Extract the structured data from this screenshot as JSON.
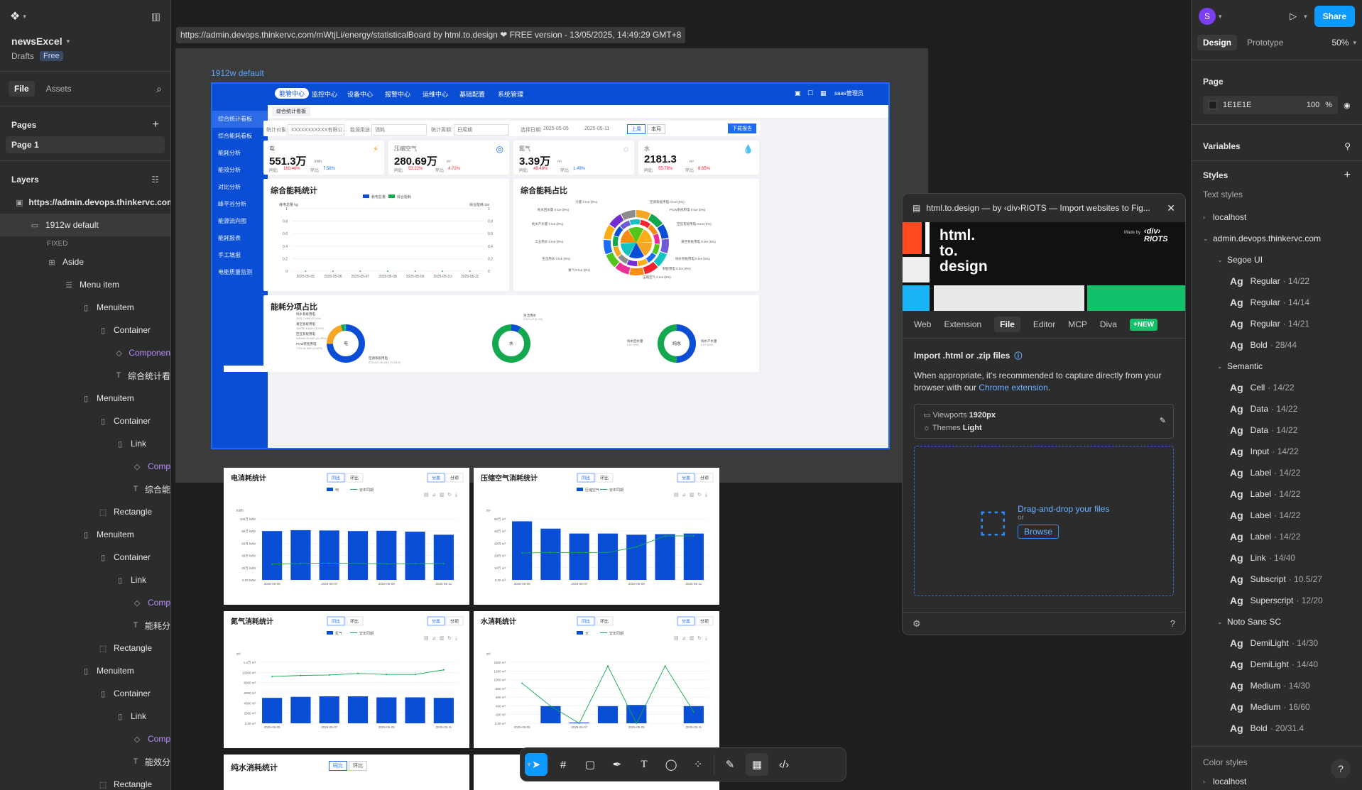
{
  "left": {
    "file_name": "newsExcel",
    "drafts": "Drafts",
    "plan": "Free",
    "tab_file": "File",
    "tab_assets": "Assets",
    "pages_title": "Pages",
    "page1": "Page 1",
    "layers_title": "Layers",
    "layers": [
      {
        "label": "https://admin.devops.thinkervc.com/",
        "icon": "▣",
        "indent": 16,
        "bold": true
      },
      {
        "label": "1912w default",
        "icon": "▭",
        "indent": 36
      },
      {
        "label": "FIXED",
        "icon": "",
        "indent": 60,
        "small": true
      },
      {
        "label": "Aside",
        "icon": "⊞",
        "indent": 60
      },
      {
        "label": "Menu item",
        "icon": "☰",
        "indent": 84
      },
      {
        "label": "Menuitem",
        "icon": "▯",
        "indent": 108
      },
      {
        "label": "Container",
        "icon": "▯",
        "indent": 132
      },
      {
        "label": "Componen",
        "icon": "◇",
        "indent": 156,
        "purple": true
      },
      {
        "label": "综合统计看",
        "icon": "T",
        "indent": 156
      },
      {
        "label": "Menuitem",
        "icon": "▯",
        "indent": 108
      },
      {
        "label": "Container",
        "icon": "▯",
        "indent": 132
      },
      {
        "label": "Link",
        "icon": "▯",
        "indent": 156
      },
      {
        "label": "Comp",
        "icon": "◇",
        "indent": 180,
        "purple": true
      },
      {
        "label": "综合能",
        "icon": "T",
        "indent": 180
      },
      {
        "label": "Rectangle",
        "icon": "⬚",
        "indent": 132
      },
      {
        "label": "Menuitem",
        "icon": "▯",
        "indent": 108
      },
      {
        "label": "Container",
        "icon": "▯",
        "indent": 132
      },
      {
        "label": "Link",
        "icon": "▯",
        "indent": 156
      },
      {
        "label": "Comp",
        "icon": "◇",
        "indent": 180,
        "purple": true
      },
      {
        "label": "能耗分",
        "icon": "T",
        "indent": 180
      },
      {
        "label": "Rectangle",
        "icon": "⬚",
        "indent": 132
      },
      {
        "label": "Menuitem",
        "icon": "▯",
        "indent": 108
      },
      {
        "label": "Container",
        "icon": "▯",
        "indent": 132
      },
      {
        "label": "Link",
        "icon": "▯",
        "indent": 156
      },
      {
        "label": "Comp",
        "icon": "◇",
        "indent": 180,
        "purple": true
      },
      {
        "label": "能效分",
        "icon": "T",
        "indent": 180
      },
      {
        "label": "Rectangle",
        "icon": "⬚",
        "indent": 132
      }
    ]
  },
  "canvas": {
    "url_label": "https://admin.devops.thinkervc.com/mWtjLi/energy/statisticalBoard by html.to.design ❤ FREE version - 13/05/2025, 14:49:29 GMT+8",
    "frame_label": "1912w default"
  },
  "dashboard": {
    "nav": [
      "能管中心",
      "监控中心",
      "设备中心",
      "报警中心",
      "运维中心",
      "基础配置",
      "系统管理"
    ],
    "user": "saas管理员",
    "side": [
      "综合统计看板",
      "综合能耗看板",
      "能耗分析",
      "能效分析",
      "对比分析",
      "峰平谷分析",
      "能源流向图",
      "能耗报表",
      "手工填报",
      "电能质量监测"
    ],
    "crumb": "综合统计看板",
    "filters": {
      "obj_label": "统计对象:",
      "obj_value": "XXXXXXXXXXX有限公...",
      "use_label": "能源用途:",
      "use_value": "消耗",
      "period_label": "统计周期:",
      "period_value": "日周期",
      "date_label": "选择日期:",
      "date_from": "2025-05-05",
      "date_to": "2025-05-11",
      "btn_prev": "上周",
      "btn_month": "本月",
      "btn_download": "下载报告"
    },
    "kpis": [
      {
        "name": "电",
        "value": "551.3万",
        "unit": "kWh",
        "yoy_label": "同比",
        "yoy": "160.46%",
        "mom_label": "环比",
        "mom": "7.58%",
        "color": "#f5a623"
      },
      {
        "name": "压缩空气",
        "value": "280.69万",
        "unit": "m³",
        "yoy_label": "同比",
        "yoy": "53.22%",
        "mom_label": "环比",
        "mom": "4.72%",
        "color": "#1b6cf2"
      },
      {
        "name": "氮气",
        "value": "3.39万",
        "unit": "m³",
        "yoy_label": "同比",
        "yoy": "48.49%",
        "mom_label": "环比",
        "mom": "1.49%",
        "color": "#6f5bd6"
      },
      {
        "name": "水",
        "value": "2181.3",
        "unit": "m³",
        "yoy_label": "同比",
        "yoy": "55.78%",
        "mom_label": "环比",
        "mom": "8.65%",
        "color": "#13c2a3"
      }
    ],
    "stat_title": "综合能耗统计",
    "stat_legend": [
      "耗电总量",
      "综合能耗"
    ],
    "stat_ylabel_left": "耗电总量 kg",
    "stat_ylabel_right": "综合能耗 tce",
    "ratio_title": "综合能耗占比",
    "ratio_labels": [
      "冷量 0 tce (0%)",
      "纯水回水量 0 tce (0%)",
      "纯水产水量 0 tce (0%)",
      "工业用水 0 tce (0%)",
      "生活用水 0 tce (0%)",
      "氮气 0 tce (0%)",
      "空调系统用电 0 tce (0%)",
      "PCW系统用电 0 tce (0%)",
      "空压系统用电 0 tce (0%)",
      "真空系统用电 0 tce (0%)",
      "纯水系统用电 0 tce (0%)",
      "制程用电 0 tce (0%)",
      "压缩空气 0 tce (0%)"
    ],
    "split_title": "能耗分项占比",
    "donut1": {
      "center": "电",
      "labels": [
        "纯水系统用电",
        "4245.7 kWh (0.14%)",
        "真空系统用电",
        "100060.6 kWh (3.24%)",
        "空压系统用电",
        "608468.55 kWh (21.05%)",
        "PCW系统用电",
        "1791.81 kWh (0.06%)",
        "空调系统用电",
        "2313422.36 kWh (74.81%)"
      ]
    },
    "donut2": {
      "center": "水",
      "labels": [
        "生活用水",
        "178.9 m³ (8.2%)",
        "工业用水",
        "2002.4 m³ (91.8%)"
      ]
    },
    "donut3": {
      "center": "纯水",
      "labels": [
        "纯水回水量",
        "0 m³ (0%)",
        "纯水产水量",
        "0 m³ (0%)"
      ]
    }
  },
  "chart_data": [
    {
      "type": "line",
      "title": "综合能耗统计",
      "categories": [
        "2025-05-05",
        "2025-05-06",
        "2025-05-07",
        "2025-05-08",
        "2025-05-09",
        "2025-05-10",
        "2025-05-11"
      ],
      "series": [
        {
          "name": "耗电总量",
          "values": [
            0,
            0,
            0,
            0,
            0,
            0,
            0
          ]
        },
        {
          "name": "综合能耗",
          "values": [
            0,
            0,
            0,
            0,
            0,
            0,
            0
          ]
        }
      ],
      "ylim": [
        0,
        1
      ],
      "yticks": [
        0,
        0.2,
        0.4,
        0.6,
        0.8,
        1
      ]
    },
    {
      "type": "bar",
      "title": "电消耗统计",
      "unit": "kWh",
      "categories": [
        "2025-05-05",
        "2025-05-06",
        "2025-05-07",
        "2025-05-08",
        "2025-05-09",
        "2025-05-10",
        "2025-05-11"
      ],
      "series": [
        {
          "name": "电",
          "values": [
            800000,
            815000,
            810000,
            800000,
            805000,
            790000,
            740000
          ]
        },
        {
          "name": "去年同期",
          "values": [
            260000,
            270000,
            275000,
            270000,
            265000,
            268000,
            270000
          ]
        }
      ],
      "ylim": [
        0,
        1000000
      ],
      "yticks": [
        "0.00 kWh",
        "20万 kWh",
        "40万 kWh",
        "60万 kWh",
        "80万 kWh",
        "100万 kWh"
      ],
      "xticks": [
        "2025-05-05",
        "2025-05-07",
        "2025-05-09",
        "2025-05-11"
      ]
    },
    {
      "type": "bar",
      "title": "压缩空气消耗统计",
      "unit": "m³",
      "categories": [
        "2025-05-05",
        "2025-05-06",
        "2025-05-07",
        "2025-05-08",
        "2025-05-09",
        "2025-05-10",
        "2025-05-11"
      ],
      "series": [
        {
          "name": "压缩空气",
          "values": [
            480000,
            420000,
            380000,
            380000,
            370000,
            375000,
            380000
          ]
        },
        {
          "name": "去年同期",
          "values": [
            220000,
            225000,
            225000,
            225000,
            270000,
            360000,
            360000
          ]
        }
      ],
      "ylim": [
        0,
        500000
      ],
      "yticks": [
        "0.00 m³",
        "10万 m³",
        "20万 m³",
        "30万 m³",
        "40万 m³",
        "50万 m³"
      ],
      "xticks": [
        "2025-05-05",
        "2025-05-07",
        "2025-05-09",
        "2025-05-11"
      ]
    },
    {
      "type": "bar",
      "title": "氮气消耗统计",
      "unit": "m³",
      "categories": [
        "2025-05-05",
        "2025-05-06",
        "2025-05-07",
        "2025-05-08",
        "2025-05-09",
        "2025-05-10",
        "2025-05-11"
      ],
      "series": [
        {
          "name": "氮气",
          "values": [
            5000,
            5200,
            5300,
            5300,
            5100,
            5100,
            5000
          ]
        },
        {
          "name": "去年同期",
          "values": [
            9200,
            9400,
            9500,
            9800,
            9600,
            9600,
            10500
          ]
        }
      ],
      "ylim": [
        0,
        12000
      ],
      "yticks": [
        "0.00 m³",
        "2000 m³",
        "4000 m³",
        "6000 m³",
        "8000 m³",
        "10000 m³",
        "1.2万 m³"
      ],
      "xticks": [
        "2025-05-05",
        "2025-05-07",
        "2025-05-09",
        "2025-05-11"
      ]
    },
    {
      "type": "bar",
      "title": "水消耗统计",
      "unit": "m³",
      "categories": [
        "2025-05-05",
        "2025-05-06",
        "2025-05-07",
        "2025-05-08",
        "2025-05-09",
        "2025-05-10",
        "2025-05-11"
      ],
      "series": [
        {
          "name": "水",
          "values": [
            0,
            450,
            20,
            450,
            480,
            0,
            450
          ]
        },
        {
          "name": "去年同期",
          "values": [
            1050,
            450,
            0,
            1500,
            0,
            1500,
            300
          ]
        }
      ],
      "ylim": [
        0,
        1600
      ],
      "yticks": [
        "0.00 m³",
        "200 m³",
        "400 m³",
        "600 m³",
        "800 m³",
        "1000 m³",
        "1200 m³",
        "1500 m³"
      ],
      "xticks": [
        "2025-05-05",
        "2025-05-07",
        "2025-05-09",
        "2025-05-11"
      ]
    }
  ],
  "lower": {
    "btn_yoy": "同比",
    "btn_mom": "环比",
    "btn_cat": "分类",
    "btn_item": "分项",
    "legend_prev": "去年同期",
    "pure_title": "纯水消耗统计"
  },
  "plugin": {
    "title": "html.to.design — by ‹div›RIOTS — Import websites to Fig...",
    "banner_text": "html.\nto.\ndesign",
    "made_by": "Made by",
    "riots": "‹div›\nRIOTS",
    "tabs": [
      "Web",
      "Extension",
      "File",
      "Editor",
      "MCP",
      "Diva"
    ],
    "new_badge": "+NEW",
    "import_title": "Import .html or .zip files",
    "import_desc_1": "When appropriate, it's recommended to capture directly from your browser with our ",
    "import_link": "Chrome extension",
    "import_desc_2": ".",
    "viewports_label": "Viewports",
    "viewports_value": "1920px",
    "themes_label": "Themes",
    "themes_value": "Light",
    "drop_text": "Drag-and-drop your files",
    "or": "or",
    "browse": "Browse"
  },
  "right": {
    "avatar": "S",
    "share": "Share",
    "tab_design": "Design",
    "tab_prototype": "Prototype",
    "zoom": "50%",
    "page_title": "Page",
    "page_color": "1E1E1E",
    "page_opacity": "100",
    "pct": "%",
    "variables": "Variables",
    "styles": "Styles",
    "text_styles": "Text styles",
    "color_styles": "Color styles",
    "tree": [
      {
        "type": "group",
        "label": "localhost",
        "depth": 0,
        "open": false
      },
      {
        "type": "group",
        "label": "admin.devops.thinkervc.com",
        "depth": 0,
        "open": true
      },
      {
        "type": "group",
        "label": "Segoe UI",
        "depth": 1,
        "open": true
      },
      {
        "type": "style",
        "label": "Regular",
        "meta": "14/22"
      },
      {
        "type": "style",
        "label": "Regular",
        "meta": "14/14"
      },
      {
        "type": "style",
        "label": "Regular",
        "meta": "14/21"
      },
      {
        "type": "style",
        "label": "Bold",
        "meta": "28/44"
      },
      {
        "type": "group",
        "label": "Semantic",
        "depth": 1,
        "open": true
      },
      {
        "type": "style",
        "label": "Cell",
        "meta": "14/22"
      },
      {
        "type": "style",
        "label": "Data",
        "meta": "14/22"
      },
      {
        "type": "style",
        "label": "Data",
        "meta": "14/22"
      },
      {
        "type": "style",
        "label": "Input",
        "meta": "14/22"
      },
      {
        "type": "style",
        "label": "Label",
        "meta": "14/22"
      },
      {
        "type": "style",
        "label": "Label",
        "meta": "14/22"
      },
      {
        "type": "style",
        "label": "Label",
        "meta": "14/22"
      },
      {
        "type": "style",
        "label": "Label",
        "meta": "14/22"
      },
      {
        "type": "style",
        "label": "Link",
        "meta": "14/40"
      },
      {
        "type": "style",
        "label": "Subscript",
        "meta": "10.5/27"
      },
      {
        "type": "style",
        "label": "Superscript",
        "meta": "12/20"
      },
      {
        "type": "group",
        "label": "Noto Sans SC",
        "depth": 1,
        "open": true
      },
      {
        "type": "style",
        "label": "DemiLight",
        "meta": "14/30"
      },
      {
        "type": "style",
        "label": "DemiLight",
        "meta": "14/40"
      },
      {
        "type": "style",
        "label": "Medium",
        "meta": "14/30"
      },
      {
        "type": "style",
        "label": "Medium",
        "meta": "16/60"
      },
      {
        "type": "style",
        "label": "Bold",
        "meta": "20/31.4"
      }
    ],
    "color_tree": [
      "localhost"
    ]
  }
}
